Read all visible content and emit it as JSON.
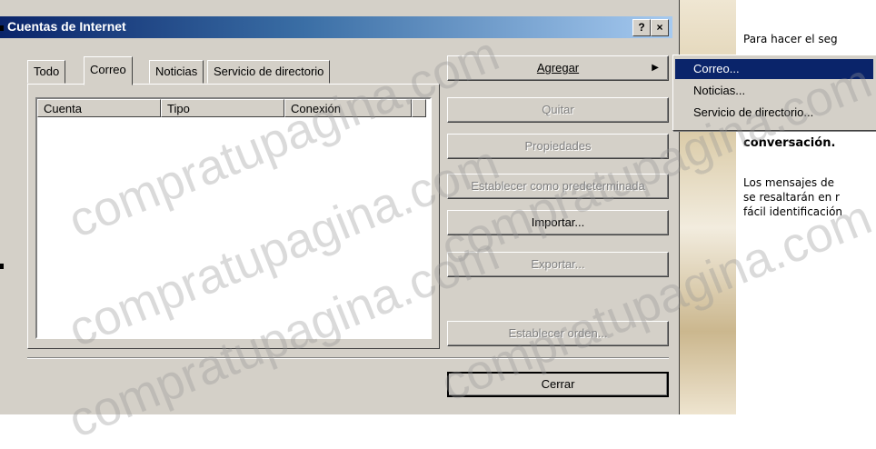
{
  "dialog": {
    "title": "Cuentas de Internet",
    "help_button": "?",
    "close_button": "×",
    "tabs": [
      {
        "label": "Todo",
        "active": false
      },
      {
        "label": "Correo",
        "active": true
      },
      {
        "label": "Noticias",
        "active": false
      },
      {
        "label": "Servicio de directorio",
        "active": false
      }
    ],
    "list": {
      "columns": [
        "Cuenta",
        "Tipo",
        "Conexión"
      ]
    },
    "buttons": {
      "agregar": "Agregar",
      "quitar": "Quitar",
      "propiedades": "Propiedades",
      "predeterminada": "Establecer como predeterminada",
      "importar": "Importar...",
      "exportar": "Exportar...",
      "orden": "Establecer orden...",
      "cerrar": "Cerrar"
    }
  },
  "submenu": {
    "items": [
      "Correo...",
      "Noticias...",
      "Servicio de directorio..."
    ],
    "selected_index": 0
  },
  "background_panel": {
    "lines": [
      "Para hacer el seg",
      "conversación.",
      "Los mensajes de",
      "se resaltarán en r",
      "fácil identificación"
    ]
  },
  "watermark": "compratupagina.com",
  "colors": {
    "titlebar_start": "#0a246a",
    "titlebar_end": "#a6caf0",
    "menu_selection": "#0a246a",
    "dialog_face": "#d4d0c8"
  }
}
